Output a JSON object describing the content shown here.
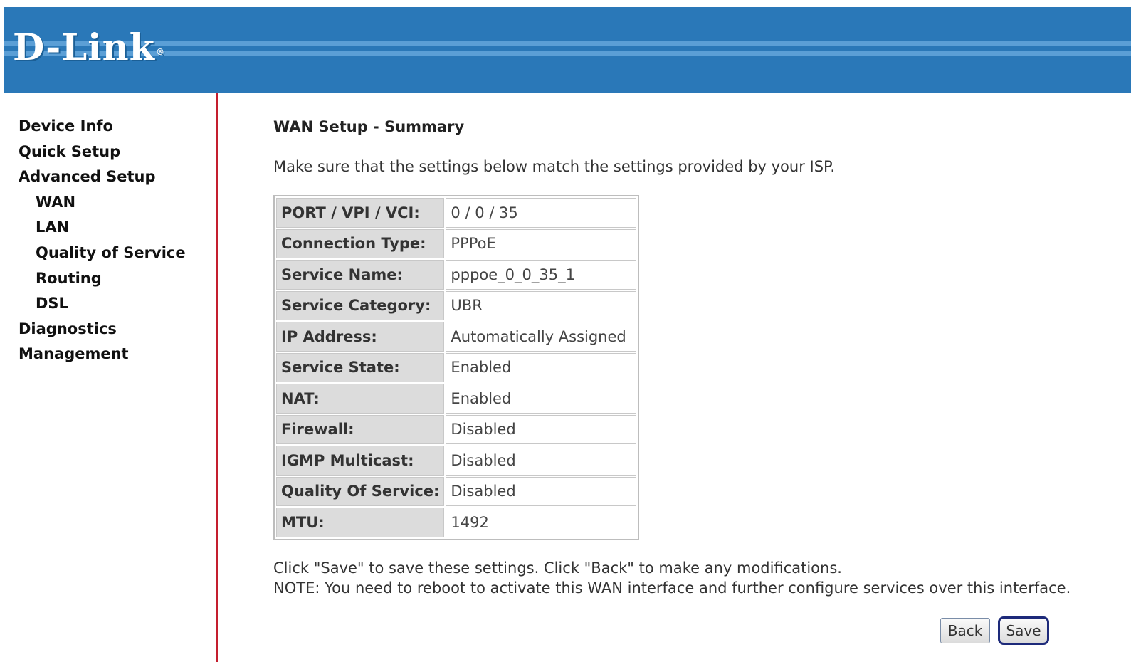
{
  "brand": {
    "logo_text": "D-Link",
    "logo_mark": "®"
  },
  "nav": {
    "items": [
      {
        "label": "Device Info",
        "level": 0
      },
      {
        "label": "Quick Setup",
        "level": 0
      },
      {
        "label": "Advanced Setup",
        "level": 0
      },
      {
        "label": "WAN",
        "level": 1
      },
      {
        "label": "LAN",
        "level": 1
      },
      {
        "label": "Quality of Service",
        "level": 1
      },
      {
        "label": "Routing",
        "level": 1
      },
      {
        "label": "DSL",
        "level": 1
      },
      {
        "label": "Diagnostics",
        "level": 0
      },
      {
        "label": "Management",
        "level": 0
      }
    ]
  },
  "page": {
    "title": "WAN Setup - Summary",
    "intro": "Make sure that the settings below match the settings provided by your ISP.",
    "summary": [
      {
        "label": "PORT / VPI / VCI:",
        "value": "0 / 0 / 35"
      },
      {
        "label": "Connection Type:",
        "value": "PPPoE"
      },
      {
        "label": "Service Name:",
        "value": "pppoe_0_0_35_1"
      },
      {
        "label": "Service Category:",
        "value": "UBR"
      },
      {
        "label": "IP Address:",
        "value": "Automatically Assigned"
      },
      {
        "label": "Service State:",
        "value": "Enabled"
      },
      {
        "label": "NAT:",
        "value": "Enabled"
      },
      {
        "label": "Firewall:",
        "value": "Disabled"
      },
      {
        "label": "IGMP Multicast:",
        "value": "Disabled"
      },
      {
        "label": "Quality Of Service:",
        "value": "Disabled"
      },
      {
        "label": "MTU:",
        "value": "1492"
      }
    ],
    "note_line1": "Click \"Save\" to save these settings. Click \"Back\" to make any modifications.",
    "note_line2": "NOTE: You need to reboot to activate this WAN interface and further configure services over this interface."
  },
  "buttons": {
    "back_label": "Back",
    "save_label": "Save"
  },
  "colors": {
    "header_blue": "#2a78b8",
    "header_stripe": "#5b9fd6",
    "sidebar_border": "#c41e2e",
    "label_cell_bg": "#dcdcdc"
  }
}
